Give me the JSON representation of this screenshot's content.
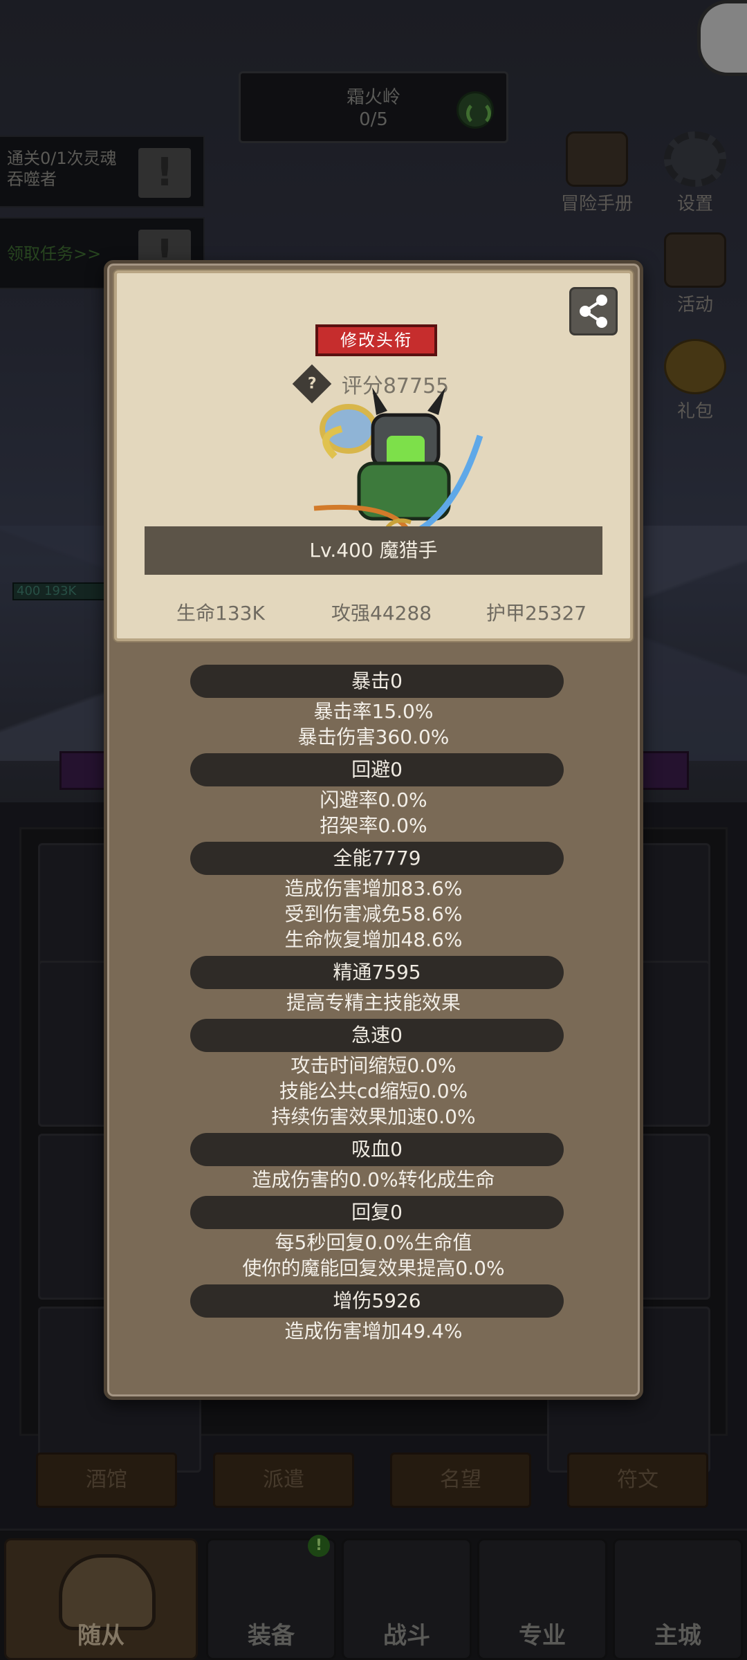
{
  "background": {
    "stage_name": "霜火岭",
    "stage_progress": "0/5",
    "quests": [
      {
        "text": "通关0/1次灵魂吞噬者"
      },
      {
        "text": "领取任务>>"
      }
    ],
    "quest_alert": "!",
    "side_icons": [
      {
        "label": "冒险手册",
        "icon": "book-icon"
      },
      {
        "label": "设置",
        "icon": "gear-icon"
      },
      {
        "label": "活动",
        "icon": "scroll-icon"
      },
      {
        "label": "礼包",
        "icon": "gift-icon"
      }
    ],
    "hero_level": "400",
    "hero_hp": "193K",
    "nav_boards": [
      "酒馆",
      "派遣",
      "名望",
      "符文"
    ],
    "tabs": [
      {
        "label": "随从",
        "active": true
      },
      {
        "label": "装备"
      },
      {
        "label": "战斗"
      },
      {
        "label": "专业"
      },
      {
        "label": "主城"
      }
    ],
    "notify_badge": "!"
  },
  "profile": {
    "title_button": "修改头衔",
    "help_icon": "?",
    "score": "评分87755",
    "name": "Lv.400 魔猎手",
    "stats": [
      {
        "text": "生命133K"
      },
      {
        "text": "攻强44288"
      },
      {
        "text": "护甲25327"
      }
    ]
  },
  "attributes": [
    {
      "header": "暴击0",
      "lines": [
        "暴击率15.0%",
        "暴击伤害360.0%"
      ]
    },
    {
      "header": "回避0",
      "lines": [
        "闪避率0.0%",
        "招架率0.0%"
      ]
    },
    {
      "header": "全能7779",
      "lines": [
        "造成伤害增加83.6%",
        "受到伤害减免58.6%",
        "生命恢复增加48.6%"
      ]
    },
    {
      "header": "精通7595",
      "lines": [
        "提高专精主技能效果"
      ]
    },
    {
      "header": "急速0",
      "lines": [
        "攻击时间缩短0.0%",
        "技能公共cd缩短0.0%",
        "持续伤害效果加速0.0%"
      ]
    },
    {
      "header": "吸血0",
      "lines": [
        "造成伤害的0.0%转化成生命"
      ]
    },
    {
      "header": "回复0",
      "lines": [
        "每5秒回复0.0%生命值",
        "使你的魔能回复效果提高0.0%"
      ]
    },
    {
      "header": "增伤5926",
      "lines": [
        "造成伤害增加49.4%"
      ]
    }
  ]
}
